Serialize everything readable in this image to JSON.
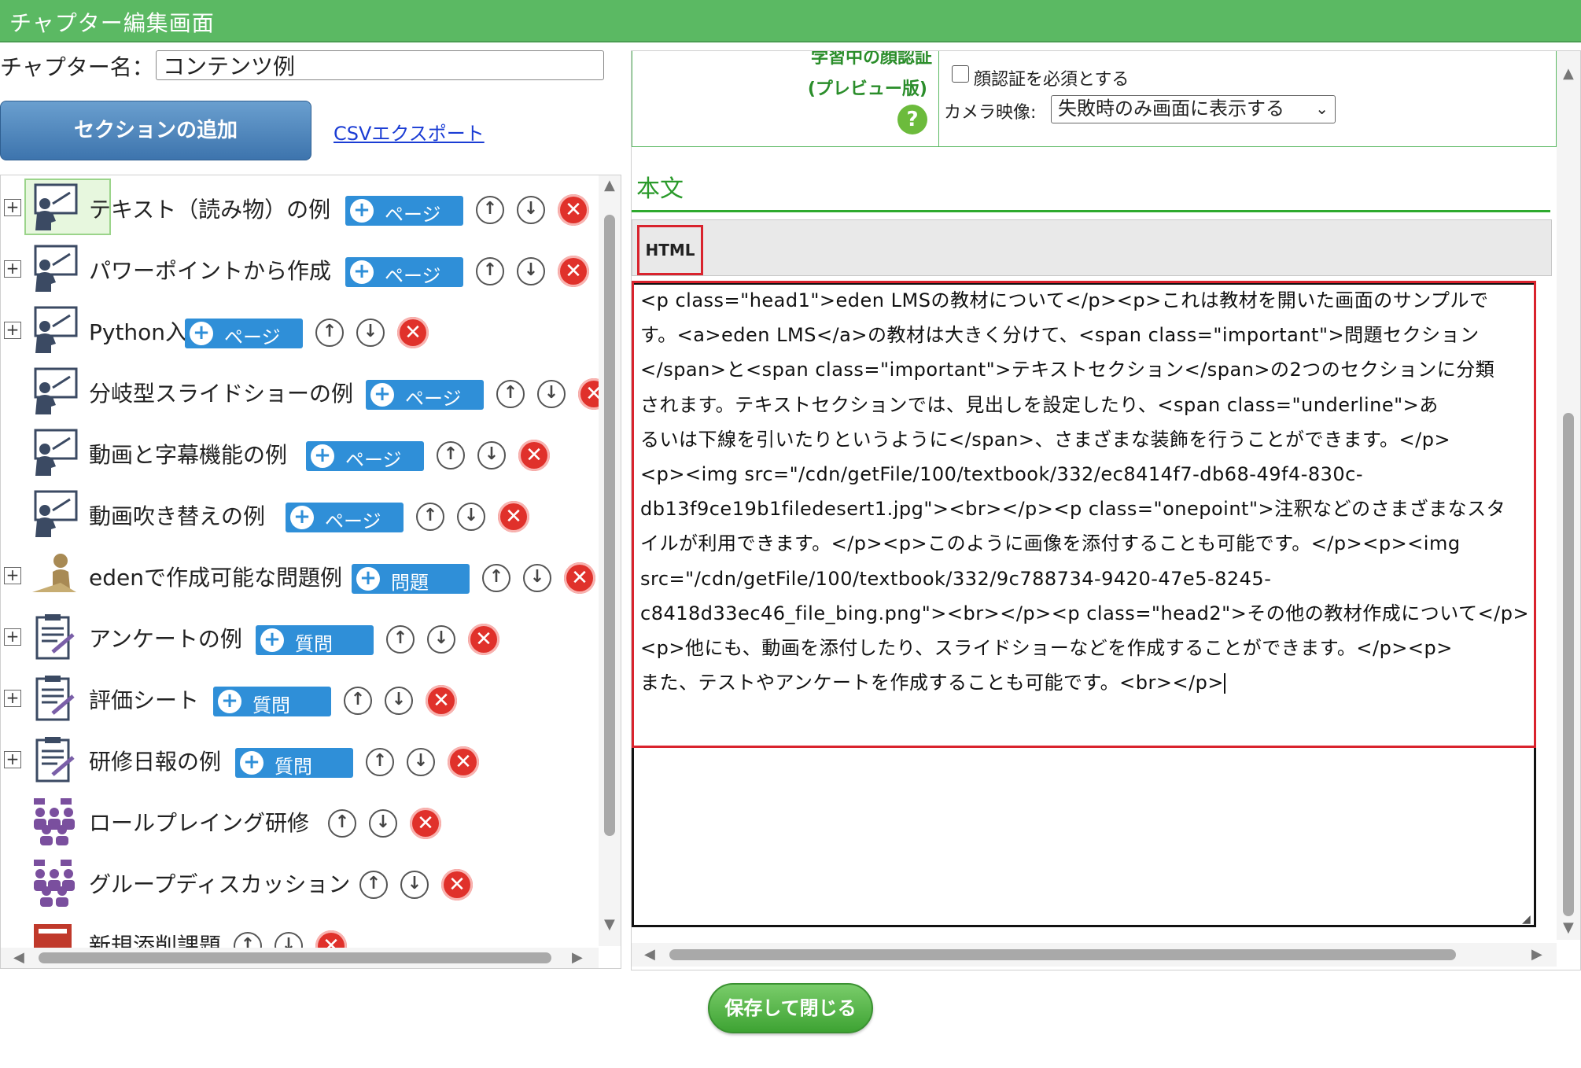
{
  "window": {
    "title": "チャプター編集画面"
  },
  "chapter": {
    "label": "チャプター名：",
    "value": "コンテンツ例"
  },
  "actions": {
    "add_section": "セクションの追加",
    "csv_export": "CSVエクスポート",
    "save_close": "保存して閉じる"
  },
  "tree": {
    "items": [
      {
        "label": "テキスト（読み物）の例",
        "icon": "teacher-icon",
        "badge": "ページ",
        "expandable": true,
        "selected": true
      },
      {
        "label": "パワーポイントから作成",
        "icon": "teacher-icon",
        "badge": "ページ",
        "expandable": true
      },
      {
        "label": "Python入門",
        "icon": "teacher-icon",
        "badge": "ページ",
        "expandable": true
      },
      {
        "label": "分岐型スライドショーの例",
        "icon": "teacher-icon",
        "badge": "ページ",
        "expandable": false
      },
      {
        "label": "動画と字幕機能の例",
        "icon": "teacher-icon",
        "badge": "ページ",
        "expandable": false
      },
      {
        "label": "動画吹き替えの例",
        "icon": "teacher-icon",
        "badge": "ページ",
        "expandable": false
      },
      {
        "label": "edenで作成可能な問題例",
        "icon": "student-desk-icon",
        "badge": "問題",
        "expandable": true
      },
      {
        "label": "アンケートの例",
        "icon": "clipboard-icon",
        "badge": "質問",
        "expandable": true
      },
      {
        "label": "評価シート",
        "icon": "clipboard-icon",
        "badge": "質問",
        "expandable": true
      },
      {
        "label": "研修日報の例",
        "icon": "clipboard-icon",
        "badge": "質問",
        "expandable": true
      },
      {
        "label": "ロールプレイング研修",
        "icon": "group-icon",
        "badge": "",
        "expandable": false
      },
      {
        "label": "グループディスカッション",
        "icon": "group-icon",
        "badge": "",
        "expandable": false
      },
      {
        "label": "新規添削課題",
        "icon": "document-icon",
        "badge": "",
        "expandable": false
      }
    ]
  },
  "face_auth": {
    "title_line1": "学習中の顔認証",
    "title_line2": "(プレビュー版)",
    "help": "?",
    "require_label": "顔認証を必須とする",
    "require_checked": false,
    "camera_label": "カメラ映像:",
    "camera_value": "失敗時のみ画面に表示する"
  },
  "body": {
    "title": "本文",
    "html_button": "HTML",
    "lines": [
      "<p class=\"head1\">eden LMSの教材について</p><p>これは教材を開いた画面のサンプルで",
      "す。<a>eden LMS</a>の教材は大きく分けて、<span class=\"important\">問題セクション",
      "</span>と<span class=\"important\">テキストセクション</span>の2つのセクションに分類",
      "されます。テキストセクションでは、見出しを設定したり、<span class=\"underline\">あ",
      "るいは下線を引いたりというように</span>、さまざまな装飾を行うことができます。</p>",
      "<p><img src=\"/cdn/getFile/100/textbook/332/ec8414f7-db68-49f4-830c-",
      "db13f9ce19b1filedesert1.jpg\"><br></p><p class=\"onepoint\">注釈などのさまざまなスタ",
      "イルが利用できます。</p><p>このように画像を添付することも可能です。</p><p><img",
      "src=\"/cdn/getFile/100/textbook/332/9c788734-9420-47e5-8245-",
      "c8418d33ec46_file_bing.png\"><br></p><p class=\"head2\">その他の教材作成について</p>",
      "<p>他にも、動画を添付したり、スライドショーなどを作成することができます。</p><p>",
      "また、テストやアンケートを作成することも可能です。<br></p>"
    ]
  },
  "colors": {
    "header_green": "#5bb963",
    "accent_blue": "#2f8fd8",
    "delete_red": "#e0312b",
    "highlight_red": "#d9232d"
  }
}
